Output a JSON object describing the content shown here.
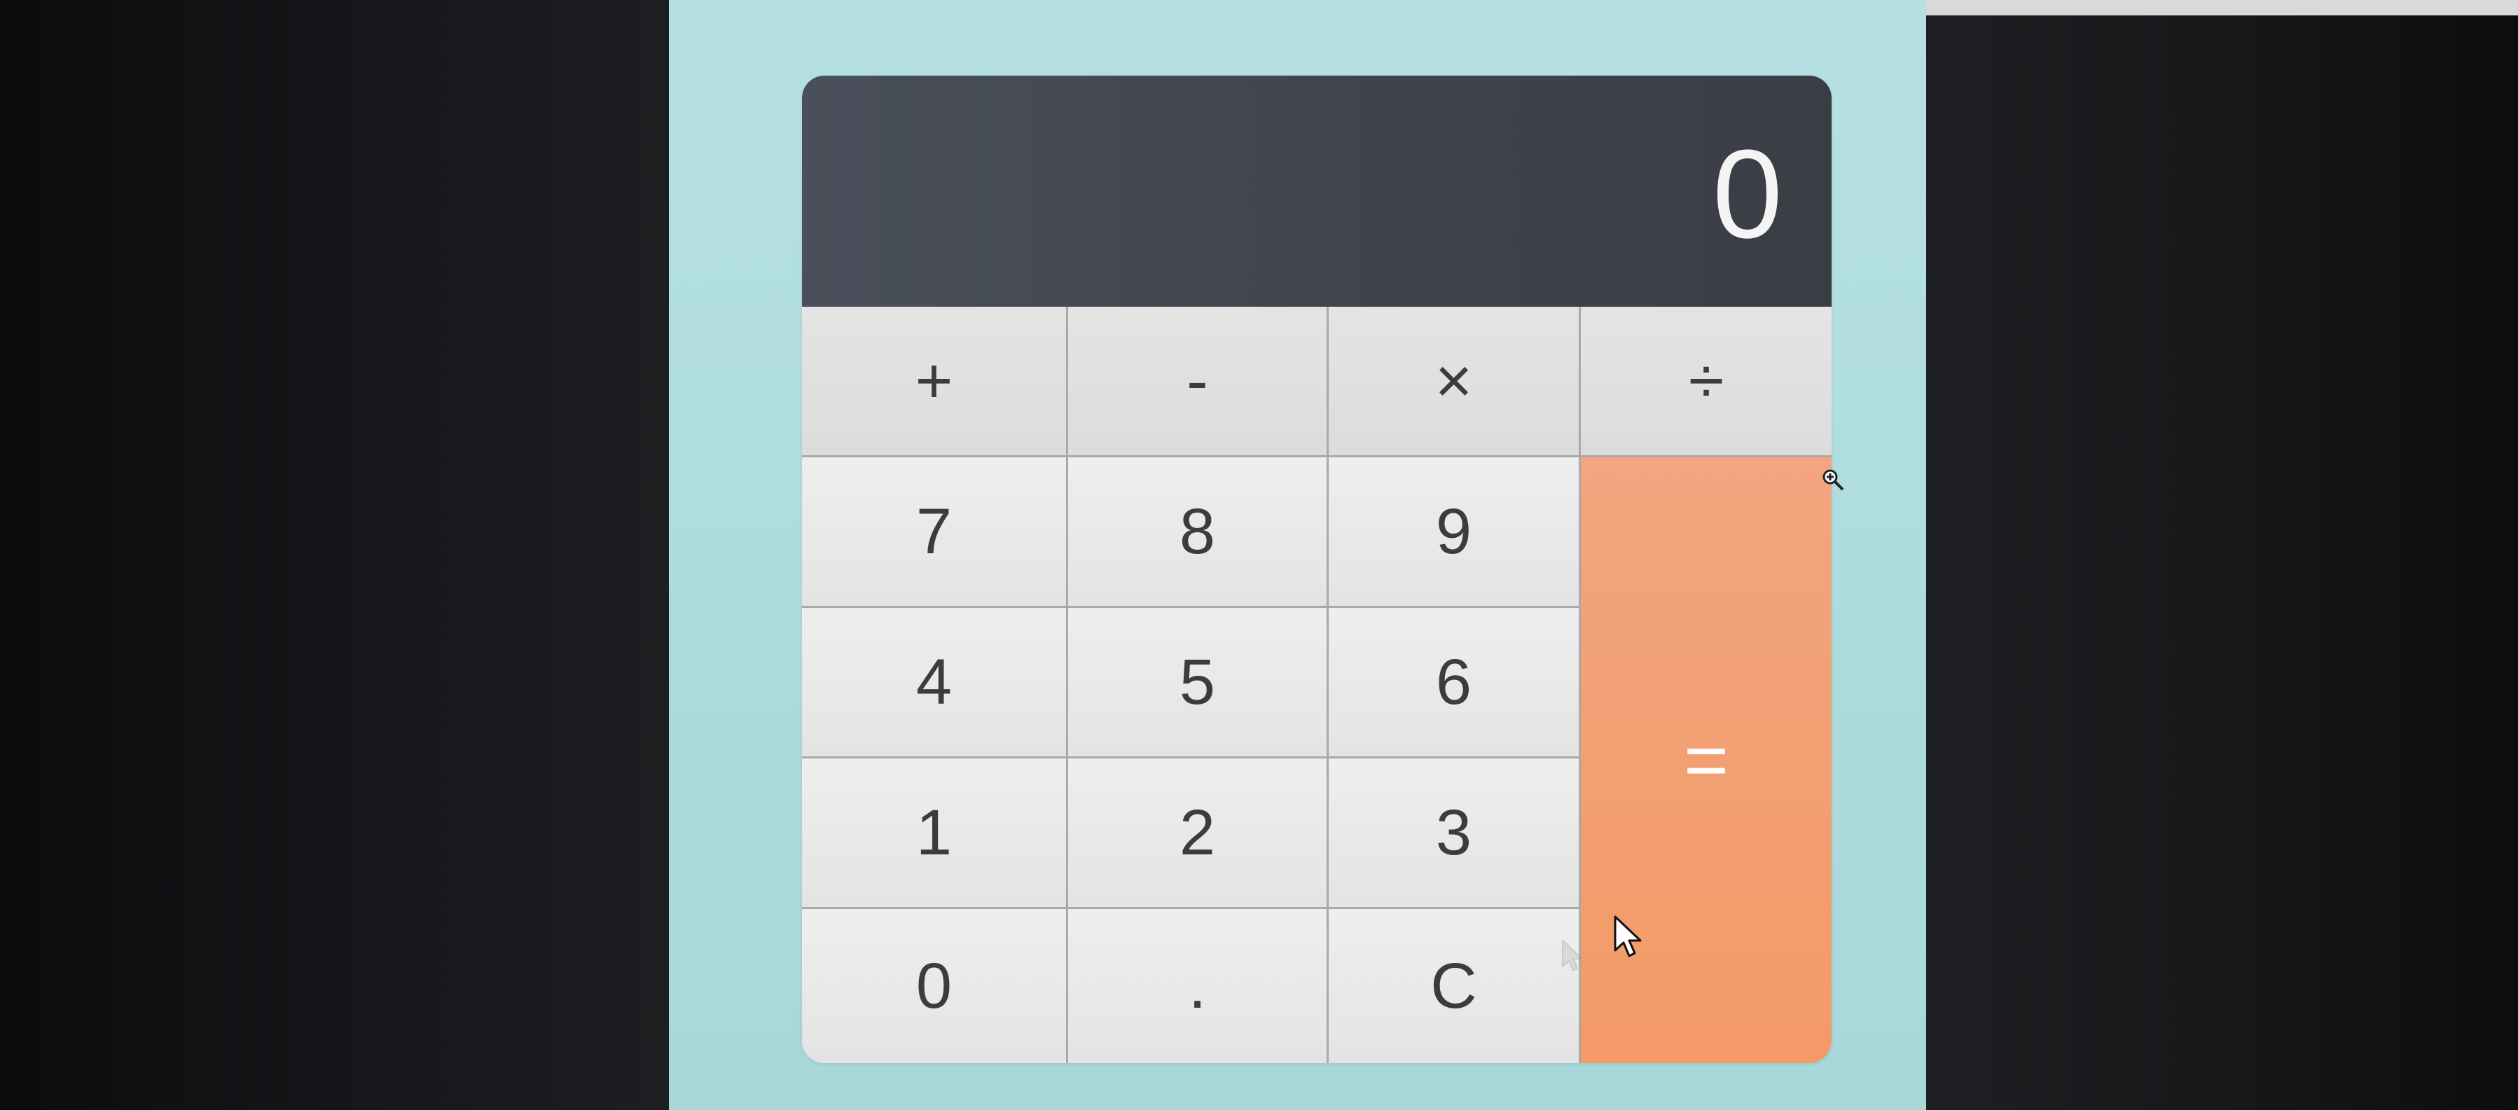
{
  "display": {
    "value": "0"
  },
  "keys": {
    "add": "+",
    "subtract": "-",
    "multiply": "×",
    "divide": "÷",
    "seven": "7",
    "eight": "8",
    "nine": "9",
    "four": "4",
    "five": "5",
    "six": "6",
    "one": "1",
    "two": "2",
    "three": "3",
    "zero": "0",
    "decimal": ".",
    "clear": "C",
    "equals": "="
  },
  "colors": {
    "background": "#aad9db",
    "display": "#444851",
    "key": "#e8e8e8",
    "equals": "#f39e6f"
  },
  "icons": [
    "zoom-in-cursor-icon",
    "arrow-cursor-icon"
  ]
}
